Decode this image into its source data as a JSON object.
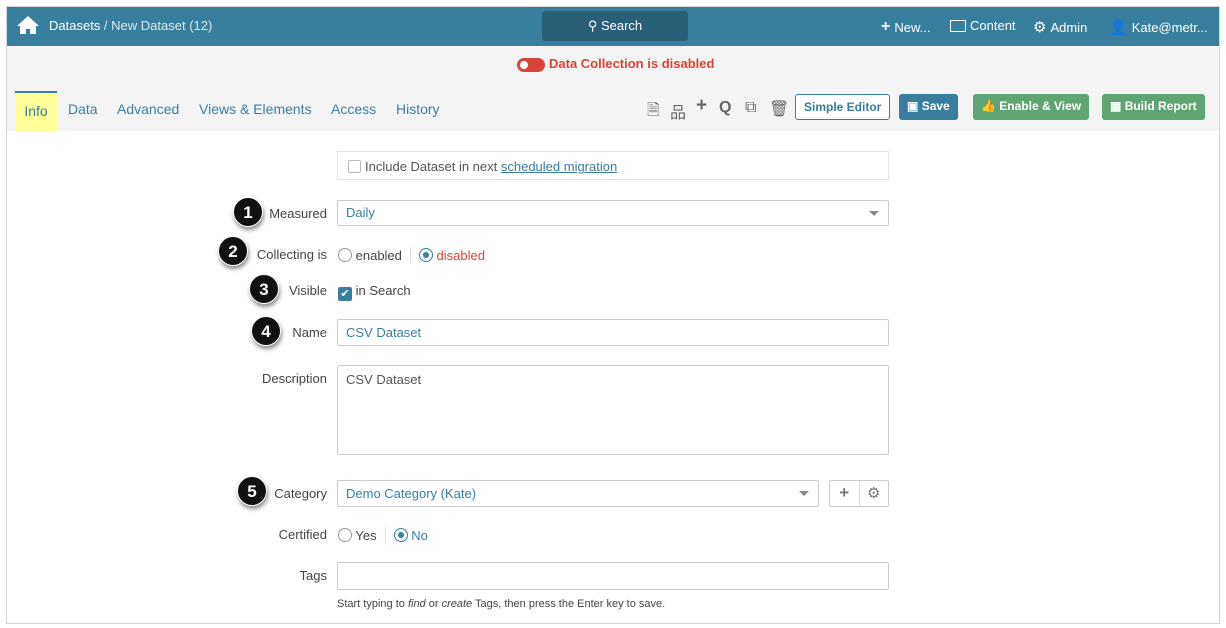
{
  "header": {
    "breadcrumb_root": "Datasets",
    "breadcrumb_sep": " / ",
    "breadcrumb_current": "New Dataset (12)",
    "search_label": "Search",
    "new_label": "New...",
    "content_label": "Content",
    "admin_label": "Admin",
    "user_label": "Kate@metr..."
  },
  "status": {
    "text": "Data Collection is disabled",
    "color": "#d9443a"
  },
  "tabs": [
    {
      "label": "Info"
    },
    {
      "label": "Data"
    },
    {
      "label": "Advanced"
    },
    {
      "label": "Views & Elements"
    },
    {
      "label": "Access"
    },
    {
      "label": "History"
    }
  ],
  "toolbar": {
    "simple_editor": "Simple Editor",
    "save": "Save",
    "enable_view": "Enable & View",
    "build_report": "Build Report"
  },
  "form": {
    "migration_prefix": "Include Dataset in next ",
    "migration_link": "scheduled migration",
    "measured_label": "Measured",
    "measured_value": "Daily",
    "collecting_label": "Collecting is",
    "collecting_enabled": "enabled",
    "collecting_disabled": "disabled",
    "visible_label": "Visible",
    "visible_option": "in Search",
    "name_label": "Name",
    "name_value": "CSV Dataset",
    "description_label": "Description",
    "description_value": "CSV Dataset",
    "category_label": "Category",
    "category_value": "Demo Category (Kate)",
    "certified_label": "Certified",
    "certified_yes": "Yes",
    "certified_no": "No",
    "tags_label": "Tags",
    "tags_value": "",
    "help_1": "Start typing to ",
    "help_find": "find",
    "help_2": " or ",
    "help_create": "create",
    "help_3": " Tags, then press the Enter key to save."
  },
  "badges": [
    "1",
    "2",
    "3",
    "4",
    "5"
  ]
}
